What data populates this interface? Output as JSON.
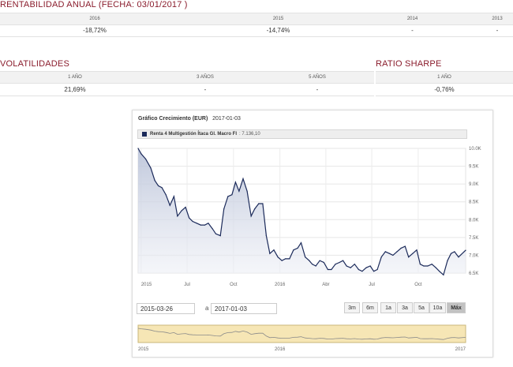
{
  "rentabilidad": {
    "title": "RENTABILIDAD ANUAL (FECHA:  03/01/2017 )",
    "headers": [
      "2016",
      "2015",
      "2014",
      "2013"
    ],
    "values": [
      "-18,72%",
      "-14,74%",
      "-",
      "-"
    ]
  },
  "volatilidades": {
    "title": "VOLATILIDADES",
    "headers": [
      "1 AÑO",
      "3 AÑOS",
      "5 AÑOS"
    ],
    "values": [
      "21,69%",
      "-",
      "-"
    ]
  },
  "sharpe": {
    "title": "RATIO SHARPE",
    "header": "1 AÑO",
    "value": "-0,76%"
  },
  "chart": {
    "title": "Gráfico Crecimiento (EUR)",
    "date": "2017-01-03",
    "legend_name": "Renta 4 Multigestión Ítaca Gl. Macro FI",
    "legend_value": ":  7.136,10",
    "date_from": "2015-03-26",
    "date_sep": "a",
    "date_to": "2017-01-03",
    "range_buttons": [
      "3m",
      "6m",
      "1a",
      "3a",
      "5a",
      "10a",
      "Máx"
    ],
    "active_range": "Máx",
    "navigator_labels": [
      "2015",
      "2016",
      "2017"
    ],
    "series_color": "#1b2a5a"
  },
  "chart_data": {
    "type": "area",
    "title": "Gráfico Crecimiento (EUR)",
    "series": [
      {
        "name": "Renta 4 Multigestión Ítaca Gl. Macro FI"
      }
    ],
    "x_tick_labels": [
      "2015",
      "Jul",
      "Oct",
      "2016",
      "Abr",
      "Jul",
      "Oct"
    ],
    "y_tick_labels": [
      "6.5K",
      "7.0K",
      "7.5K",
      "8.0K",
      "8.5K",
      "9.0K",
      "9.5K",
      "10.0K"
    ],
    "ylim": [
      6.5,
      10.0
    ],
    "x": [
      "2015-03-26",
      "2015-04-01",
      "2015-04-10",
      "2015-04-20",
      "2015-04-28",
      "2015-05-05",
      "2015-05-12",
      "2015-05-20",
      "2015-05-28",
      "2015-06-05",
      "2015-06-12",
      "2015-06-20",
      "2015-06-28",
      "2015-07-05",
      "2015-07-12",
      "2015-07-20",
      "2015-07-28",
      "2015-08-05",
      "2015-08-12",
      "2015-08-20",
      "2015-08-27",
      "2015-09-05",
      "2015-09-12",
      "2015-09-20",
      "2015-09-28",
      "2015-10-05",
      "2015-10-12",
      "2015-10-20",
      "2015-10-28",
      "2015-11-05",
      "2015-11-12",
      "2015-11-20",
      "2015-11-28",
      "2015-12-05",
      "2015-12-12",
      "2015-12-20",
      "2015-12-28",
      "2016-01-05",
      "2016-01-12",
      "2016-01-20",
      "2016-01-28",
      "2016-02-05",
      "2016-02-12",
      "2016-02-20",
      "2016-02-28",
      "2016-03-05",
      "2016-03-12",
      "2016-03-20",
      "2016-03-28",
      "2016-04-05",
      "2016-04-12",
      "2016-04-20",
      "2016-04-28",
      "2016-05-05",
      "2016-05-12",
      "2016-05-20",
      "2016-05-28",
      "2016-06-05",
      "2016-06-12",
      "2016-06-20",
      "2016-06-28",
      "2016-07-05",
      "2016-07-12",
      "2016-07-20",
      "2016-07-28",
      "2016-08-05",
      "2016-08-12",
      "2016-08-20",
      "2016-08-28",
      "2016-09-05",
      "2016-09-12",
      "2016-09-20",
      "2016-09-28",
      "2016-10-05",
      "2016-10-12",
      "2016-10-20",
      "2016-10-28",
      "2016-11-05",
      "2016-11-12",
      "2016-11-20",
      "2016-11-28",
      "2016-12-05",
      "2016-12-12",
      "2016-12-20",
      "2017-01-03"
    ],
    "y": [
      10.0,
      9.85,
      9.7,
      9.45,
      9.1,
      8.95,
      8.9,
      8.7,
      8.4,
      8.65,
      8.1,
      8.25,
      8.35,
      8.05,
      7.95,
      7.9,
      7.85,
      7.85,
      7.9,
      7.75,
      7.6,
      7.55,
      8.3,
      8.65,
      8.7,
      9.05,
      8.8,
      9.15,
      8.8,
      8.1,
      8.3,
      8.45,
      8.45,
      7.55,
      7.05,
      7.15,
      6.95,
      6.85,
      6.9,
      6.9,
      7.15,
      7.2,
      7.35,
      6.95,
      6.85,
      6.75,
      6.7,
      6.85,
      6.8,
      6.6,
      6.6,
      6.75,
      6.8,
      6.85,
      6.7,
      6.65,
      6.75,
      6.6,
      6.55,
      6.65,
      6.7,
      6.55,
      6.6,
      6.95,
      7.1,
      7.05,
      7.0,
      7.1,
      7.2,
      7.25,
      6.95,
      7.05,
      7.15,
      6.75,
      6.7,
      6.7,
      6.75,
      6.65,
      6.55,
      6.45,
      6.85,
      7.05,
      7.1,
      6.95,
      7.14
    ],
    "grid": true,
    "legend_position": "top"
  }
}
